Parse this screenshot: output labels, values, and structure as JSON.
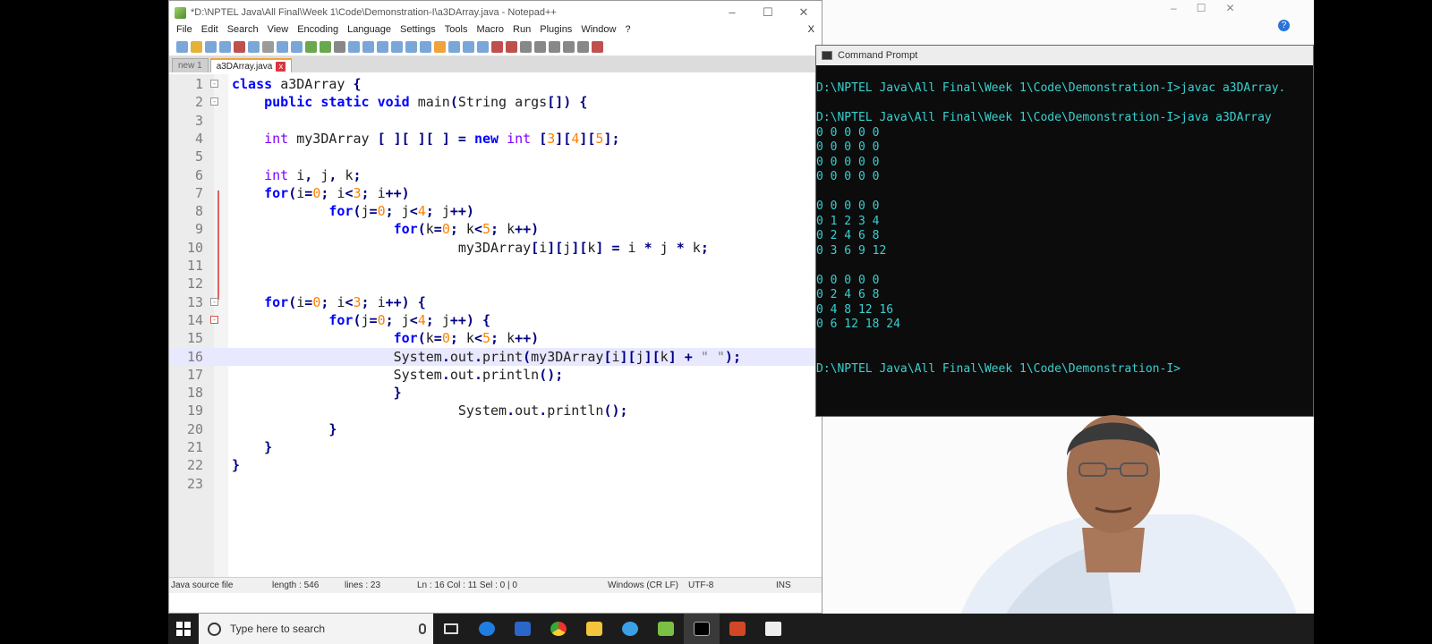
{
  "notepad": {
    "title": "*D:\\NPTEL Java\\All Final\\Week 1\\Code\\Demonstration-I\\a3DArray.java - Notepad++",
    "menu": [
      "File",
      "Edit",
      "Search",
      "View",
      "Encoding",
      "Language",
      "Settings",
      "Tools",
      "Macro",
      "Run",
      "Plugins",
      "Window",
      "?"
    ],
    "menu_close": "X",
    "window_controls": {
      "minimize": "–",
      "maximize": "☐",
      "close": "✕"
    },
    "tabs": [
      {
        "label": "new 1",
        "active": false
      },
      {
        "label": "a3DArray.java",
        "active": true
      }
    ],
    "tab_close": "x",
    "current_line": 16,
    "code": [
      "class a3DArray {",
      "    public static void main(String args[]) {",
      "",
      "    int my3DArray [ ][ ][ ] = new int [3][4][5];",
      "",
      "    int i, j, k;",
      "    for(i=0; i<3; i++)",
      "            for(j=0; j<4; j++)",
      "                    for(k=0; k<5; k++)",
      "                            my3DArray[i][j][k] = i * j * k;",
      "",
      "",
      "    for(i=0; i<3; i++) {",
      "            for(j=0; j<4; j++) {",
      "                    for(k=0; k<5; k++)",
      "                    System.out.print(my3DArray[i][j][k] + \" \");",
      "                    System.out.println();",
      "                    }",
      "                            System.out.println();",
      "            }",
      "    }",
      "}",
      ""
    ],
    "status": {
      "file_type": "Java source file",
      "length": "length : 546",
      "lines": "lines : 23",
      "position": "Ln : 16    Col : 11    Sel : 0 | 0",
      "eol": "Windows (CR LF)",
      "encoding": "UTF-8",
      "mode": "INS"
    }
  },
  "cmd": {
    "title": "Command Prompt",
    "lines": [
      "D:\\NPTEL Java\\All Final\\Week 1\\Code\\Demonstration-I>javac a3DArray.",
      "",
      "D:\\NPTEL Java\\All Final\\Week 1\\Code\\Demonstration-I>java a3DArray",
      "0 0 0 0 0",
      "0 0 0 0 0",
      "0 0 0 0 0",
      "0 0 0 0 0",
      "",
      "0 0 0 0 0",
      "0 1 2 3 4",
      "0 2 4 6 8",
      "0 3 6 9 12",
      "",
      "0 0 0 0 0",
      "0 2 4 6 8",
      "0 4 8 12 16",
      "0 6 12 18 24",
      "",
      "",
      "D:\\NPTEL Java\\All Final\\Week 1\\Code\\Demonstration-I>"
    ]
  },
  "taskbar": {
    "search_placeholder": "Type here to search",
    "apps": [
      "task-view-icon",
      "edge-icon",
      "store-icon",
      "chrome-icon",
      "file-explorer-icon",
      "ie-icon",
      "notepadpp-icon",
      "cmd-icon",
      "powerpoint-icon",
      "feedback-icon"
    ]
  },
  "colors": {
    "keyword": "#0000ff",
    "type": "#8000ff",
    "number": "#ff8000",
    "cmd_text": "#3ad0d0",
    "active_tab": "#f2a23a"
  }
}
